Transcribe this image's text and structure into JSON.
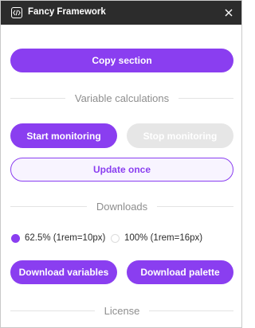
{
  "window": {
    "title": "Fancy Framework"
  },
  "actions": {
    "copy_section": "Copy section"
  },
  "variable_calculations": {
    "heading": "Variable calculations",
    "start_label": "Start monitoring",
    "stop_label": "Stop monitoring",
    "update_label": "Update once"
  },
  "downloads": {
    "heading": "Downloads",
    "options": [
      {
        "label": "62.5% (1rem=10px)",
        "selected": true
      },
      {
        "label": "100% (1rem=16px)",
        "selected": false
      }
    ],
    "download_variables": "Download variables",
    "download_palette": "Download palette"
  },
  "license": {
    "heading": "License"
  },
  "colors": {
    "accent": "#8a3ef0",
    "titlebar": "#2c2c2c",
    "disabled": "#e6e6e6"
  }
}
